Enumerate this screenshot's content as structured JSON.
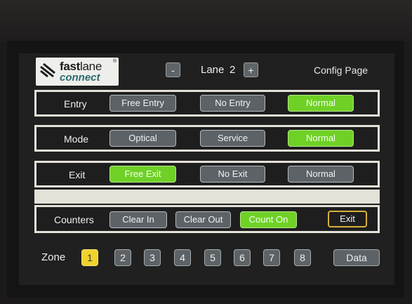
{
  "header": {
    "logo": {
      "fast": "fast",
      "lane": "lane",
      "connect": "connect",
      "reg": "®"
    },
    "minus_label": "-",
    "lane_label": "Lane",
    "lane_number": "2",
    "plus_label": "+",
    "page_title": "Config Page"
  },
  "rows": {
    "entry": {
      "label": "Entry",
      "options": [
        "Free Entry",
        "No Entry",
        "Normal"
      ],
      "selected": "Normal"
    },
    "mode": {
      "label": "Mode",
      "options": [
        "Optical",
        "Service",
        "Normal"
      ],
      "selected": "Normal"
    },
    "exit": {
      "label": "Exit",
      "options": [
        "Free Exit",
        "No Exit",
        "Normal"
      ],
      "selected": "Free Exit"
    },
    "counters": {
      "label": "Counters",
      "buttons": [
        "Clear In",
        "Clear Out",
        "Count On"
      ],
      "active": "Count On",
      "exit_label": "Exit"
    }
  },
  "zone": {
    "label": "Zone",
    "buttons": [
      "1",
      "2",
      "3",
      "4",
      "5",
      "6",
      "7",
      "8"
    ],
    "selected": "1",
    "data_label": "Data"
  },
  "colors": {
    "selected_green": "#6fd126",
    "zone_selected_yellow": "#f2d12c",
    "button_gray": "#5c6266",
    "frame": "#e4e1d8",
    "exit_outline": "#d6b23a",
    "logo_teal": "#2b6b73"
  }
}
